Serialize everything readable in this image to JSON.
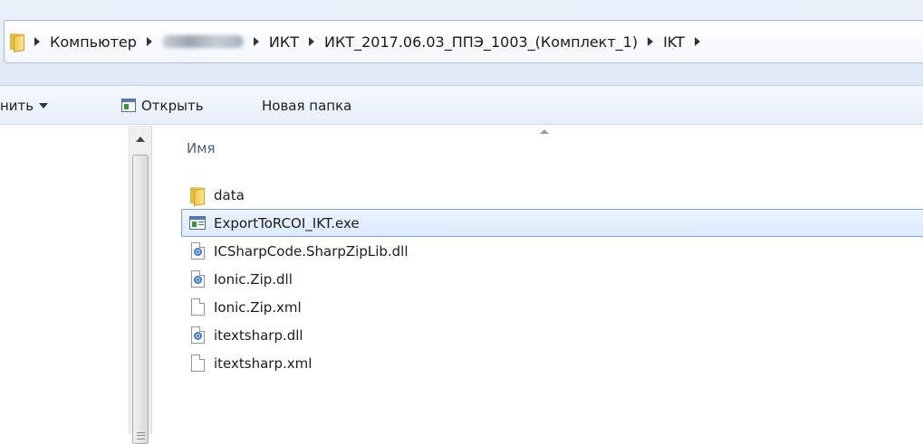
{
  "address_bar": {
    "crumbs": [
      "Компьютер",
      "",
      "ИКТ",
      "ИКТ_2017.06.03_ППЭ_1003_(Комплект_1)",
      "IKT"
    ]
  },
  "toolbar": {
    "organize_label": "нить",
    "open_label": "Открыть",
    "new_folder_label": "Новая папка"
  },
  "list": {
    "column_name": "Имя",
    "items": [
      {
        "name": "data",
        "icon": "folder-icon"
      },
      {
        "name": "ExportToRCOI_IKT.exe",
        "icon": "exe-icon",
        "selected": true
      },
      {
        "name": "ICSharpCode.SharpZipLib.dll",
        "icon": "dll-icon"
      },
      {
        "name": "Ionic.Zip.dll",
        "icon": "dll-icon"
      },
      {
        "name": "Ionic.Zip.xml",
        "icon": "file-icon"
      },
      {
        "name": "itextsharp.dll",
        "icon": "dll-icon"
      },
      {
        "name": "itextsharp.xml",
        "icon": "file-icon"
      }
    ]
  },
  "colors": {
    "selection_border": "#7da2ce",
    "selection_fill": "#dcebfc",
    "header_text": "#4c607a"
  }
}
